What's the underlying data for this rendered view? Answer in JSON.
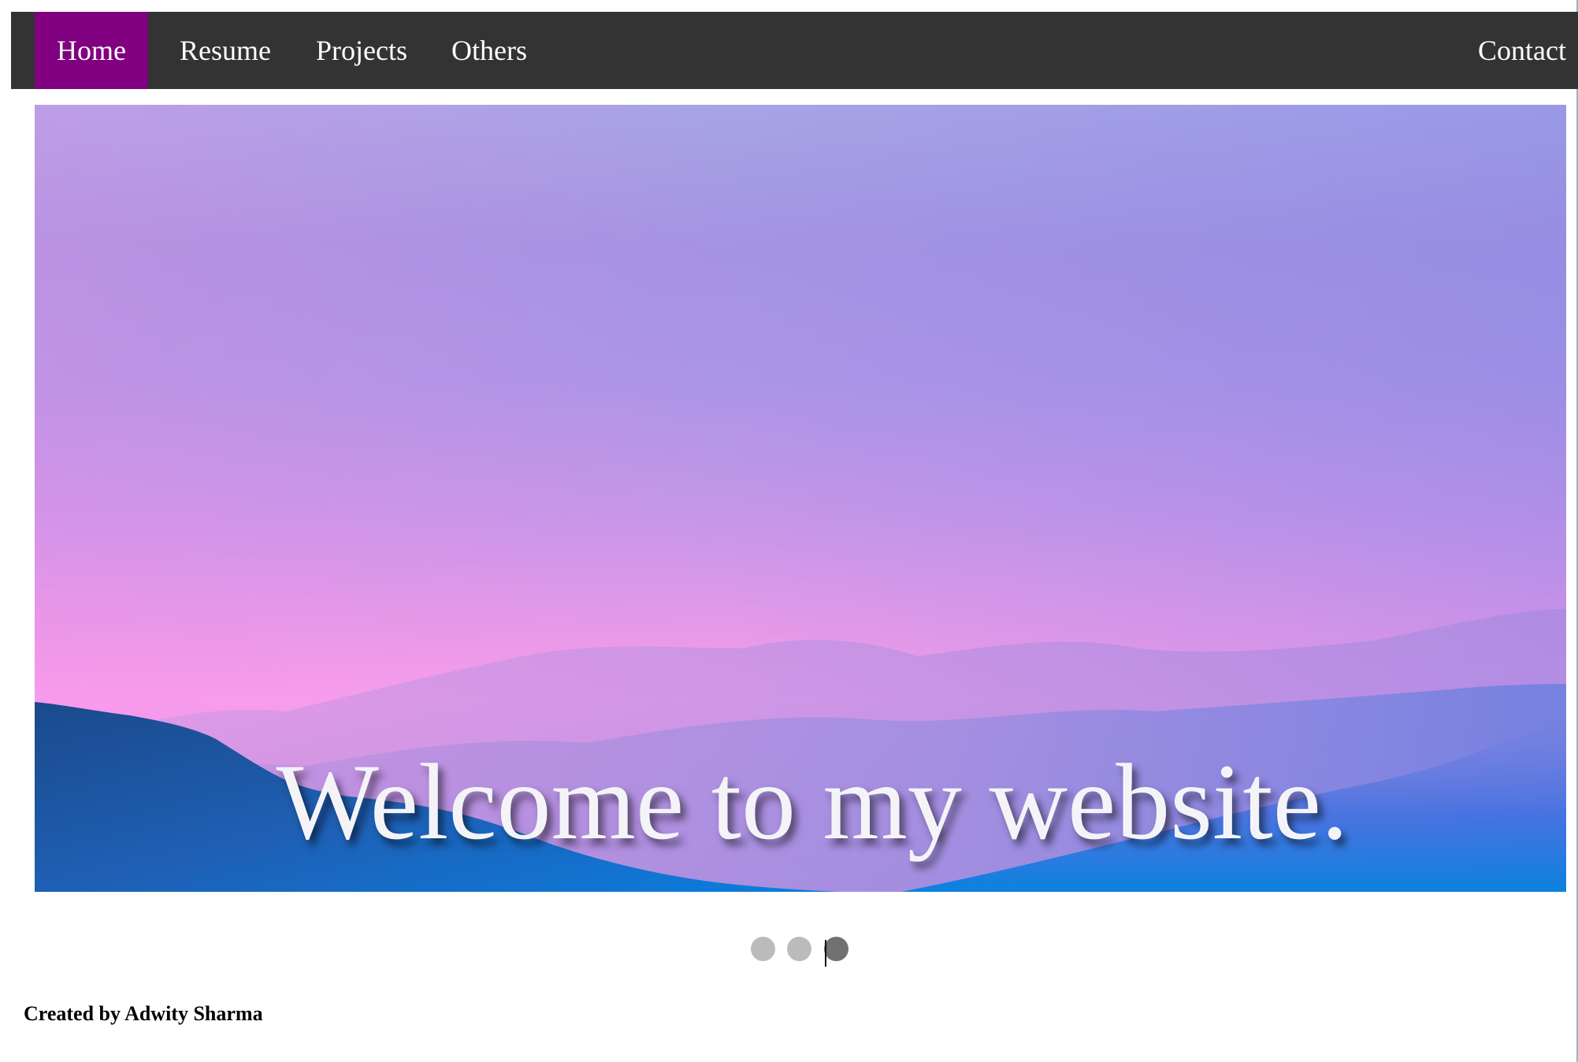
{
  "nav": {
    "items": [
      {
        "label": "Home",
        "active": true
      },
      {
        "label": "Resume",
        "active": false
      },
      {
        "label": "Projects",
        "active": false
      },
      {
        "label": "Others",
        "active": false
      }
    ],
    "contact_label": "Contact",
    "active_color": "#800080",
    "bar_color": "#333333"
  },
  "slideshow": {
    "caption": "Welcome to my website.",
    "image": "pastel-mountain-sunset",
    "slide_count": 3,
    "current_slide": 3
  },
  "footer": {
    "credit": "Created by Adwity Sharma"
  }
}
